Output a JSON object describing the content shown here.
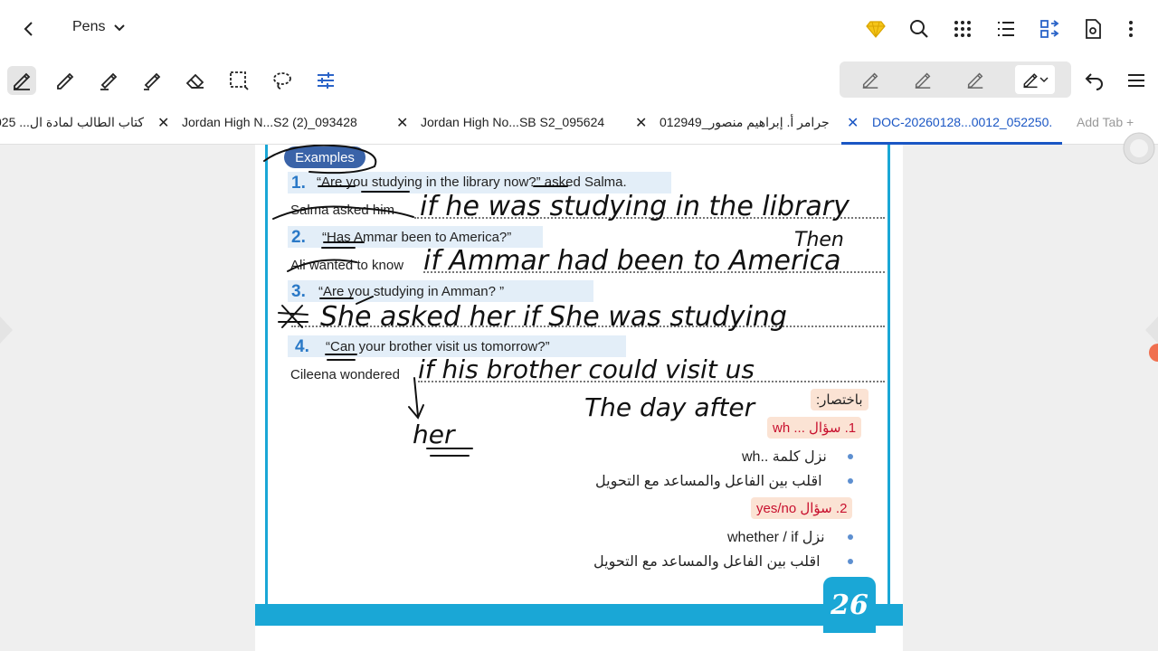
{
  "header": {
    "title": "Pens",
    "icons": [
      "back-arrow-icon",
      "chevron-down-icon",
      "premium-diamond-icon",
      "search-icon",
      "grid-apps-icon",
      "list-icon",
      "page-layout-icon",
      "document-settings-icon",
      "more-vertical-icon"
    ]
  },
  "tabs": [
    {
      "label": "كتاب الطالب لمادة ال... 025"
    },
    {
      "label": "Jordan High N...S2 (2)_093428"
    },
    {
      "label": "Jordan High No...SB S2_095624"
    },
    {
      "label": "جرامر أ. إبراهيم منصور_012949"
    },
    {
      "label": "DOC-20260128...0012_052250."
    }
  ],
  "add_tab": "Add Tab",
  "page": {
    "examples_label": "Examples",
    "numbers": [
      "1.",
      "2.",
      "3.",
      "4."
    ],
    "q1": "“Are you studying in the library now?” asked Salma.",
    "a1": "Salma asked him",
    "q2": "“Has Ammar been to America?”",
    "a2": "Ali wanted to know",
    "q3": "“Are you studying in Amman? ”",
    "q4": "“Can your brother visit us tomorrow?”",
    "a4": "Cileena wondered",
    "summary_label": "باختصار:",
    "wh_head": "1. سؤال ... wh",
    "wh_b1": "نزل كلمة ..wh",
    "wh_b2": "اقلب بين الفاعل والمساعد مع التحويل",
    "yn_head": "2. سؤال yes/no",
    "yn_b1": "نزل whether / if",
    "yn_b2": "اقلب بين الفاعل والمساعد مع التحويل",
    "page_number": "26"
  },
  "handwriting": {
    "line1": "if he was studying in the library",
    "line1b": "Then",
    "line2": "if Ammar had been to America",
    "line3": "She asked her if She was studying",
    "line4": "if his brother could visit us",
    "line4b": "The day after",
    "under": "her"
  },
  "colors": {
    "accent": "#1a56c4",
    "page_frame": "#1aa7d6",
    "badge": "#3a63a8",
    "highlight": "#e3eef8",
    "red_text": "#c8102e"
  }
}
